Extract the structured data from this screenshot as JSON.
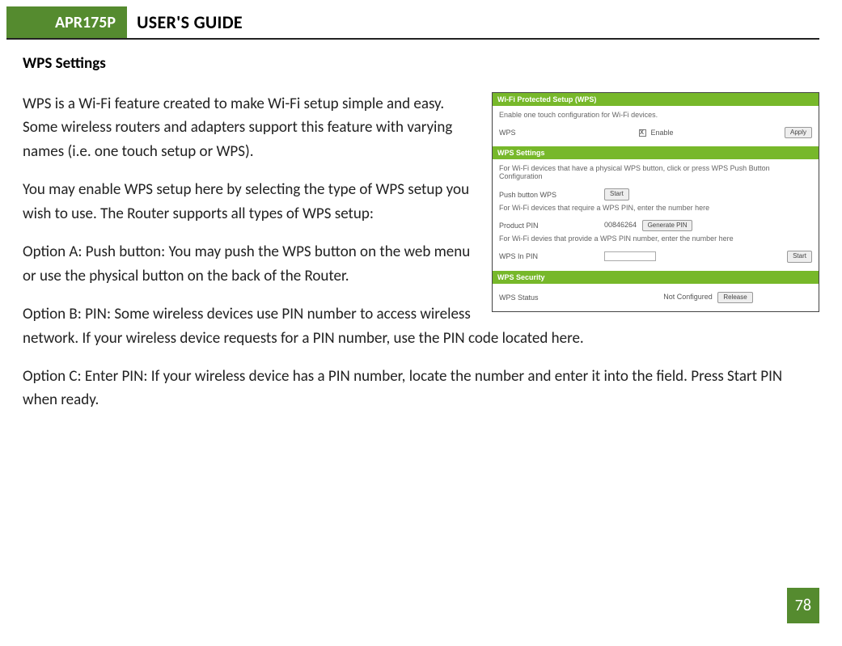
{
  "header": {
    "model": "APR175P",
    "title": "USER'S GUIDE"
  },
  "page": {
    "section_title": "WPS Settings",
    "paragraphs": {
      "p1": "WPS is a Wi-Fi feature created to make Wi-Fi setup simple and easy. Some wireless routers and adapters support this feature with varying names (i.e. one touch setup or WPS).",
      "p2": "You may enable WPS setup here by selecting the type of WPS setup you wish to use. The Router supports all types of WPS setup:",
      "p3": "Option A: Push button: You may push the WPS button on the web menu or use the physical button on the back of the Router.",
      "p4": "Option B: PIN: Some wireless devices use PIN number to access wireless network.  If your wireless device requests for a PIN number, use the PIN code located here.",
      "p5": "Option C: Enter PIN: If your wireless device has a PIN number, locate the number and enter it into the field.  Press Start PIN when ready."
    },
    "page_number": "78"
  },
  "panel": {
    "h1": "Wi-Fi Protected Setup (WPS)",
    "note1": "Enable one touch configuration for Wi-Fi devices.",
    "wps_label": "WPS",
    "enable_label": "Enable",
    "apply": "Apply",
    "h2": "WPS Settings",
    "note2": "For Wi-Fi devices that have a physical WPS button, click or press WPS Push Button Configuration",
    "push_label": "Push button WPS",
    "start": "Start",
    "note3": "For Wi-Fi devices that require a WPS PIN, enter the number here",
    "pin_label": "Product PIN",
    "pin_value": "00846264",
    "gen_pin": "Generate PIN",
    "note4": "For Wi-Fi devies that provide a WPS PIN number, enter the number here",
    "wps_in_pin": "WPS In PIN",
    "h3": "WPS Security",
    "status_label": "WPS Status",
    "status_value": "Not Configured",
    "release": "Release"
  }
}
